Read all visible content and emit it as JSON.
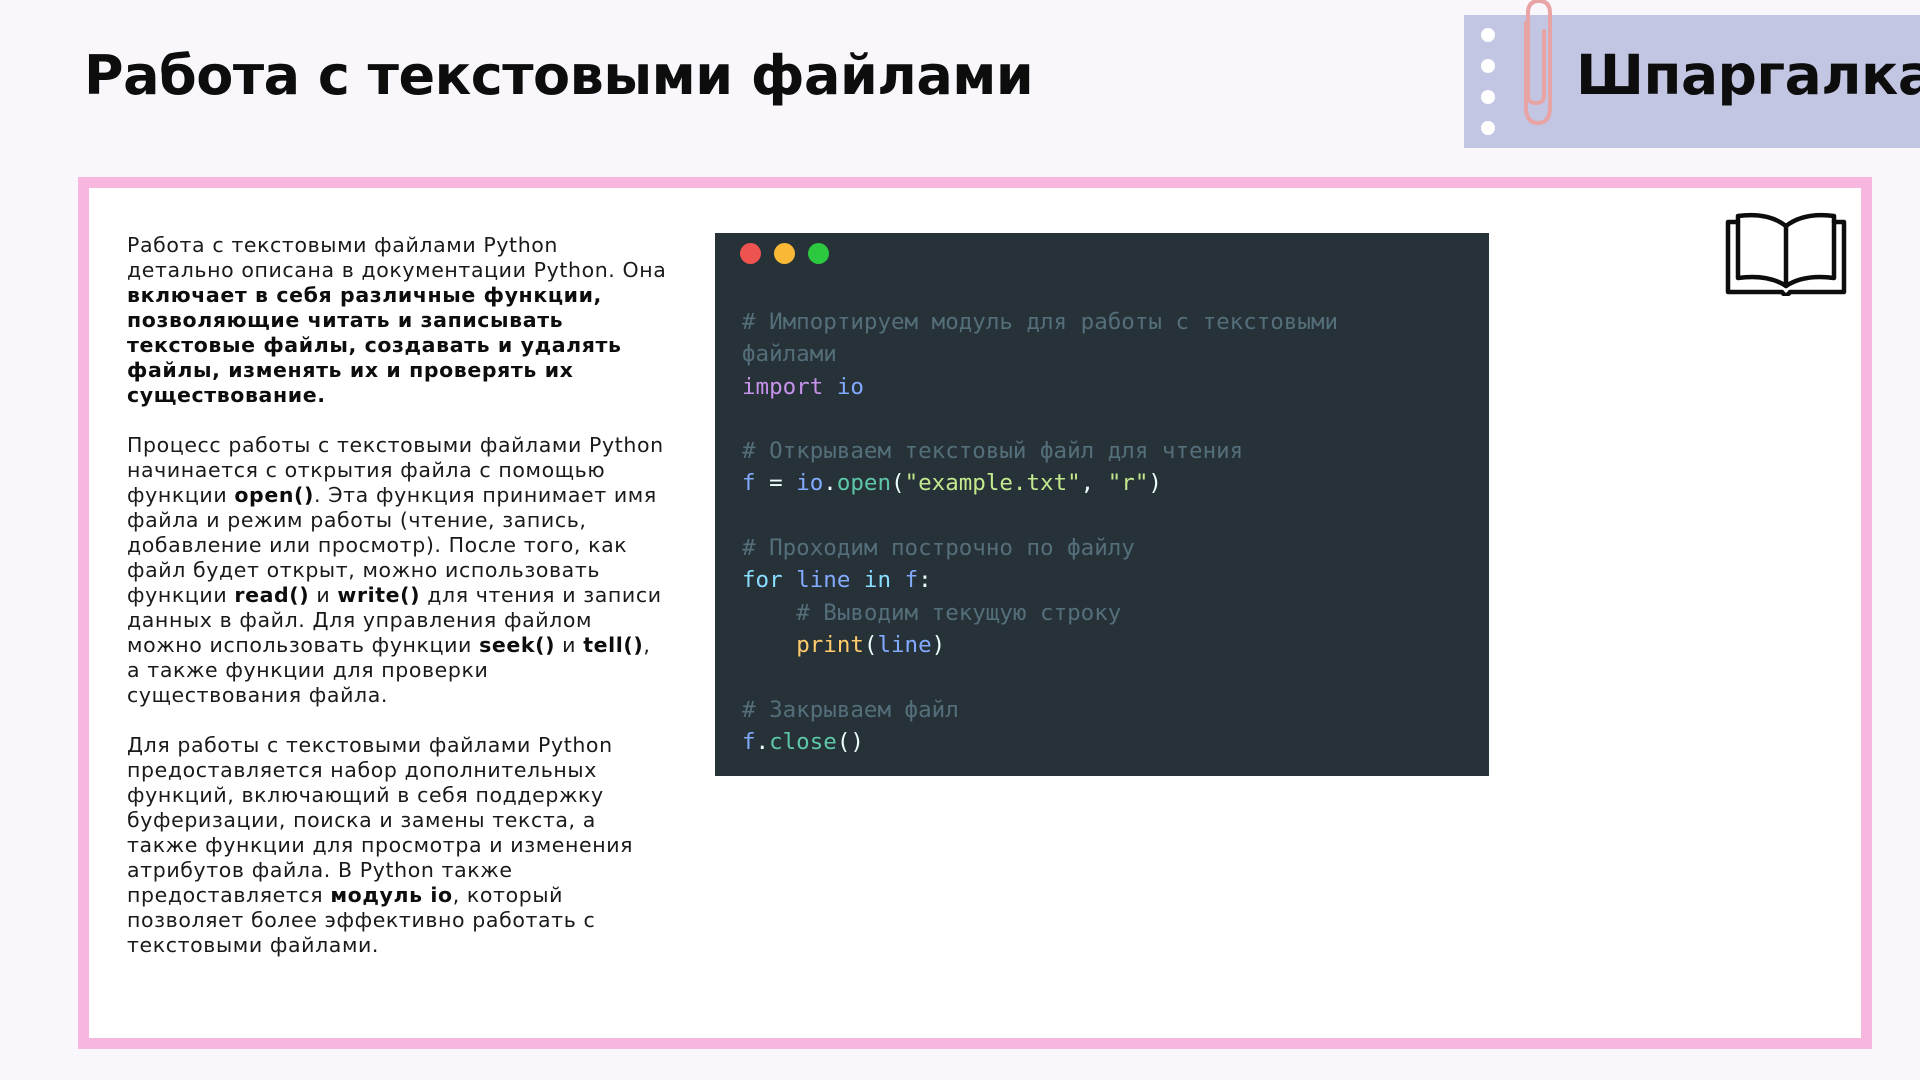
{
  "slide": {
    "title": "Работа с текстовыми файлами",
    "badge_label": "Шпаргалка",
    "badge_icon": "paperclip-icon",
    "corner_icon": "open-book-icon"
  },
  "colors": {
    "background": "#f9f7fb",
    "frame_border": "#f6b6de",
    "badge_background": "#c3c6e3",
    "code_background": "#263238"
  },
  "paragraphs": [
    [
      {
        "text": "Работа с текстовыми файлами Python детально описана в документации Python. Она ",
        "bold": false
      },
      {
        "text": "включает в себя различные функции, позволяющие читать и записывать текстовые файлы, создавать и удалять файлы, изменять их и проверять их существование.",
        "bold": true
      }
    ],
    [
      {
        "text": "Процесс работы с текстовыми файлами Python начинается с открытия файла с помощью функции ",
        "bold": false
      },
      {
        "text": "open()",
        "bold": true
      },
      {
        "text": ". Эта функция принимает имя файла и режим работы (чтение, запись, добавление или просмотр). После того, как файл будет открыт, можно использовать функции ",
        "bold": false
      },
      {
        "text": "read()",
        "bold": true
      },
      {
        "text": " и ",
        "bold": false
      },
      {
        "text": "write()",
        "bold": true
      },
      {
        "text": " для чтения и записи данных в файл. Для управления файлом можно использовать функции ",
        "bold": false
      },
      {
        "text": "seek()",
        "bold": true
      },
      {
        "text": " и ",
        "bold": false
      },
      {
        "text": "tell()",
        "bold": true
      },
      {
        "text": ", а также функции для проверки существования файла.",
        "bold": false
      }
    ],
    [
      {
        "text": "Для работы с текстовыми файлами Python предоставляется набор дополнительных функций, включающий в себя поддержку буферизации, поиска и замены текста, а также функции для просмотра и изменения атрибутов файла. В Python также предоставляется ",
        "bold": false
      },
      {
        "text": "модуль io",
        "bold": true
      },
      {
        "text": ", который позволяет более эффективно работать с текстовыми файлами.",
        "bold": false
      }
    ]
  ],
  "code_window": {
    "buttons": [
      {
        "name": "close-dot",
        "color": "#ef5350"
      },
      {
        "name": "minimize-dot",
        "color": "#f9b936"
      },
      {
        "name": "maximize-dot",
        "color": "#2bc840"
      }
    ],
    "lines": [
      [
        {
          "t": "# Импортируем модуль для работы с текстовыми",
          "c": "cm"
        }
      ],
      [
        {
          "t": "файлами",
          "c": "cm"
        }
      ],
      [
        {
          "t": "import",
          "c": "kw"
        },
        {
          "t": " ",
          "c": "p"
        },
        {
          "t": "io",
          "c": "var"
        }
      ],
      [],
      [
        {
          "t": "# Открываем текстовый файл для чтения",
          "c": "cm"
        }
      ],
      [
        {
          "t": "f",
          "c": "var"
        },
        {
          "t": " = ",
          "c": "p"
        },
        {
          "t": "io",
          "c": "var"
        },
        {
          "t": ".",
          "c": "p"
        },
        {
          "t": "open",
          "c": "fn2"
        },
        {
          "t": "(",
          "c": "p"
        },
        {
          "t": "\"example.txt\"",
          "c": "str"
        },
        {
          "t": ", ",
          "c": "p"
        },
        {
          "t": "\"r\"",
          "c": "str"
        },
        {
          "t": ")",
          "c": "p"
        }
      ],
      [],
      [
        {
          "t": "# Проходим построчно по файлу",
          "c": "cm"
        }
      ],
      [
        {
          "t": "for",
          "c": "fn"
        },
        {
          "t": " ",
          "c": "p"
        },
        {
          "t": "line",
          "c": "var"
        },
        {
          "t": " ",
          "c": "p"
        },
        {
          "t": "in",
          "c": "fn"
        },
        {
          "t": " ",
          "c": "p"
        },
        {
          "t": "f",
          "c": "var"
        },
        {
          "t": ":",
          "c": "p"
        }
      ],
      [
        {
          "t": "    ",
          "c": "p"
        },
        {
          "t": "# Выводим текущую строку",
          "c": "cm"
        }
      ],
      [
        {
          "t": "    ",
          "c": "p"
        },
        {
          "t": "print",
          "c": "pr"
        },
        {
          "t": "(",
          "c": "p"
        },
        {
          "t": "line",
          "c": "var"
        },
        {
          "t": ")",
          "c": "p"
        }
      ],
      [],
      [
        {
          "t": "# Закрываем файл",
          "c": "cm"
        }
      ],
      [
        {
          "t": "f",
          "c": "var"
        },
        {
          "t": ".",
          "c": "p"
        },
        {
          "t": "close",
          "c": "fn2"
        },
        {
          "t": "()",
          "c": "p"
        }
      ]
    ]
  }
}
